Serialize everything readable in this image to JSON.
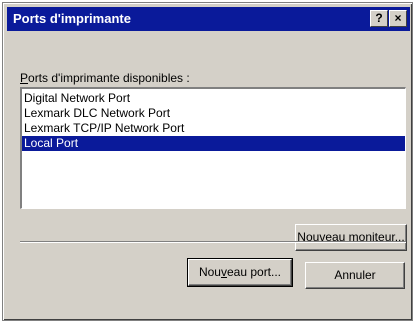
{
  "window": {
    "title": "Ports d'imprimante",
    "help_label": "?",
    "close_label": "×"
  },
  "label": {
    "mnemonic": "P",
    "rest": "orts d'imprimante disponibles :"
  },
  "ports": [
    {
      "label": "Digital Network Port",
      "selected": false
    },
    {
      "label": "Lexmark DLC Network Port",
      "selected": false
    },
    {
      "label": "Lexmark TCP/IP Network Port",
      "selected": false
    },
    {
      "label": "Local Port",
      "selected": true
    }
  ],
  "buttons": {
    "new_monitor": {
      "mnemonic": "N",
      "rest": "ouveau moniteur..."
    },
    "new_port": {
      "pre": "Nou",
      "mnemonic": "v",
      "rest": "eau port..."
    },
    "cancel": "Annuler"
  },
  "colors": {
    "titlebar": "#0a1a9a",
    "selection": "#0a1a9a",
    "face": "#d4d0c8"
  }
}
